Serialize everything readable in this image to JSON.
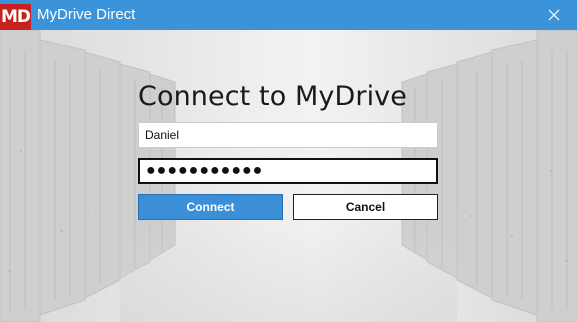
{
  "window": {
    "logo_text": "MD",
    "title": "MyDrive Direct",
    "close_icon": "close-icon",
    "accent_color": "#3b93da",
    "logo_color": "#c8201e"
  },
  "login": {
    "heading": "Connect to MyDrive",
    "username_value": "Daniel",
    "password_masked": "●●●●●●●●●●●",
    "connect_label": "Connect",
    "cancel_label": "Cancel"
  }
}
